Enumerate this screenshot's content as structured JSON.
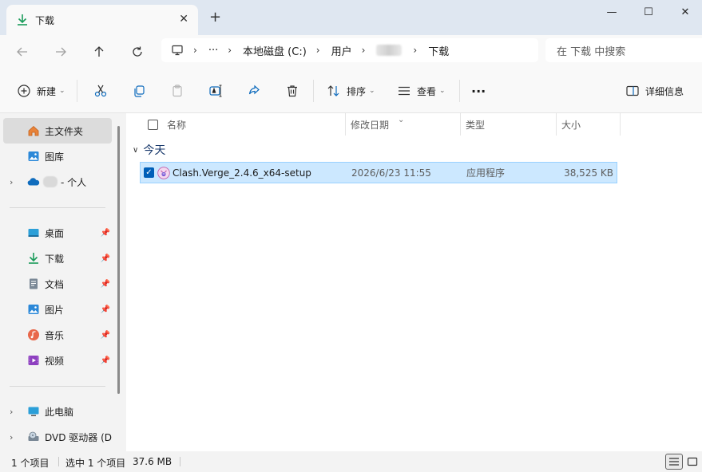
{
  "window": {
    "tab_title": "下载",
    "tab_close": "✕",
    "new_tab": "+",
    "minimize": "—",
    "maximize": "☐",
    "close": "✕"
  },
  "address": {
    "breadcrumb": [
      "本地磁盘 (C:)",
      "用户",
      "下载"
    ],
    "more": "···",
    "search_placeholder": "在 下载 中搜索"
  },
  "toolbar": {
    "new_label": "新建",
    "sort_label": "排序",
    "view_label": "查看",
    "more_label": "···",
    "details_label": "详细信息"
  },
  "sidebar": {
    "home": "主文件夹",
    "gallery": "图库",
    "onedrive": "- 个人",
    "quick_access": [
      {
        "label": "桌面"
      },
      {
        "label": "下载"
      },
      {
        "label": "文档"
      },
      {
        "label": "图片"
      },
      {
        "label": "音乐"
      },
      {
        "label": "视频"
      }
    ],
    "this_pc": "此电脑",
    "dvd": "DVD 驱动器 (D"
  },
  "columns": {
    "name": "名称",
    "date": "修改日期",
    "type": "类型",
    "size": "大小"
  },
  "group": {
    "label": "今天"
  },
  "files": [
    {
      "name": "Clash.Verge_2.4.6_x64-setup",
      "date": "2026/6/23 11:55",
      "type": "应用程序",
      "size": "38,525 KB",
      "selected": true
    }
  ],
  "status": {
    "count": "1 个项目",
    "selection": "选中 1 个项目",
    "selection_size": "37.6 MB"
  },
  "colors": {
    "accent": "#005fb8",
    "selection_bg": "#cce8ff",
    "selection_border": "#99d1ff",
    "titlebar_bg": "#dfe7f1"
  }
}
